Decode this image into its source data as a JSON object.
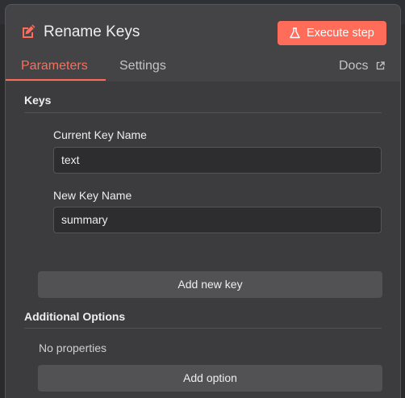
{
  "node": {
    "title": "Rename Keys",
    "icon": "edit-icon",
    "execute_label": "Execute step",
    "execute_icon": "flask-icon",
    "accent_color": "#ff6d5a"
  },
  "tabs": [
    {
      "label": "Parameters",
      "active": true
    },
    {
      "label": "Settings",
      "active": false
    },
    {
      "label": "Docs",
      "active": false,
      "icon": "external-link-icon"
    }
  ],
  "keys_section": {
    "label": "Keys",
    "current_key_label": "Current Key Name",
    "current_key_value": "text",
    "new_key_label": "New Key Name",
    "new_key_value": "summary",
    "add_button_label": "Add new key"
  },
  "options_section": {
    "label": "Additional Options",
    "empty_text": "No properties",
    "add_button_label": "Add option"
  }
}
